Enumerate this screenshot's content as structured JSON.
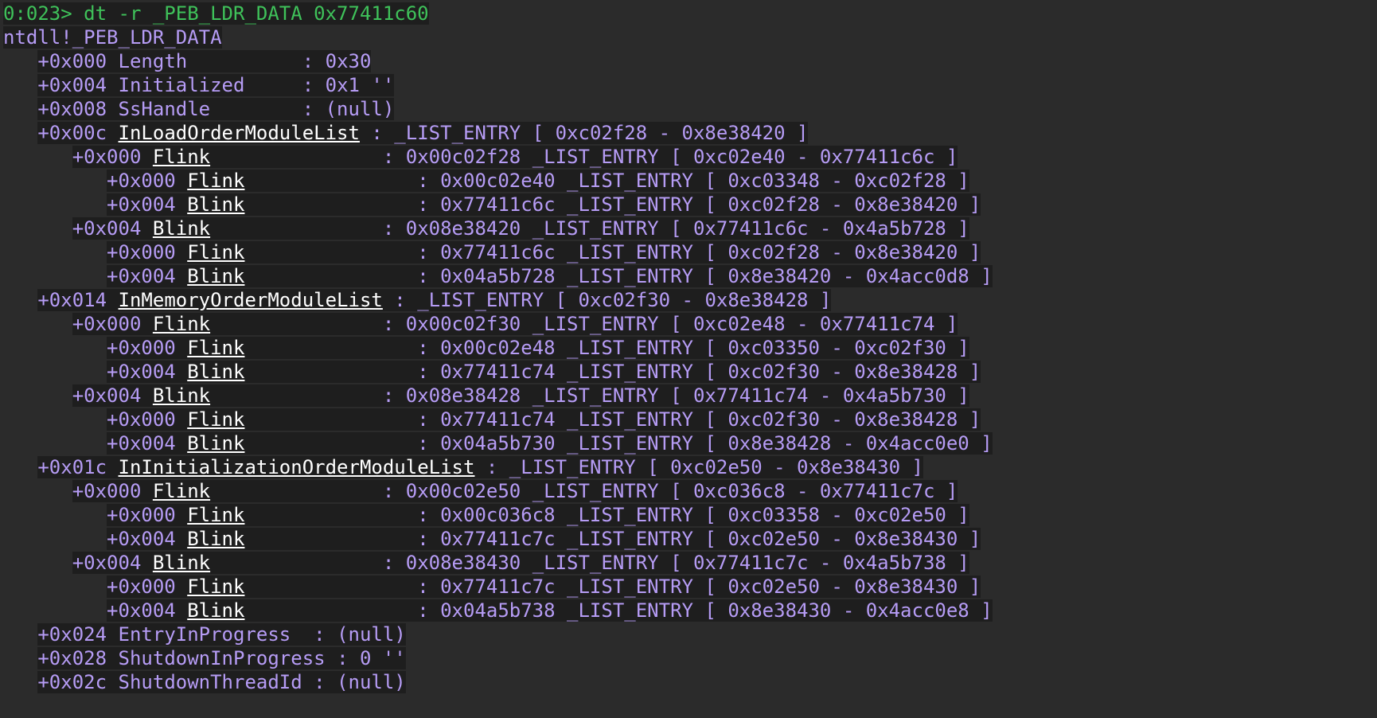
{
  "prompt": "0:023>",
  "command": "dt -r _PEB_LDR_DATA 0x77411c60",
  "colors": {
    "background": "#2b2b2b",
    "line_highlight": "#1e1e1e",
    "command": "#3fc25a",
    "output": "#b69cf5",
    "link": "#ffffff"
  },
  "lines": [
    {
      "indent": "",
      "text": "ntdll!_PEB_LDR_DATA"
    },
    {
      "indent": "   ",
      "offset": "+0x000",
      "field": "Length",
      "pad": "          ",
      "value": ": 0x30"
    },
    {
      "indent": "   ",
      "offset": "+0x004",
      "field": "Initialized",
      "pad": "     ",
      "value": ": 0x1 ''"
    },
    {
      "indent": "   ",
      "offset": "+0x008",
      "field": "SsHandle",
      "pad": "        ",
      "value": ": (null)"
    },
    {
      "indent": "   ",
      "offset": "+0x00c",
      "link": "InLoadOrderModuleList",
      "value": " : _LIST_ENTRY [ 0xc02f28 - 0x8e38420 ]"
    },
    {
      "indent": "      ",
      "offset": "+0x000",
      "link": "Flink",
      "value": "               : 0x00c02f28 _LIST_ENTRY [ 0xc02e40 - 0x77411c6c ]"
    },
    {
      "indent": "         ",
      "offset": "+0x000",
      "link": "Flink",
      "value": "               : 0x00c02e40 _LIST_ENTRY [ 0xc03348 - 0xc02f28 ]"
    },
    {
      "indent": "         ",
      "offset": "+0x004",
      "link": "Blink",
      "value": "               : 0x77411c6c _LIST_ENTRY [ 0xc02f28 - 0x8e38420 ]"
    },
    {
      "indent": "      ",
      "offset": "+0x004",
      "link": "Blink",
      "value": "               : 0x08e38420 _LIST_ENTRY [ 0x77411c6c - 0x4a5b728 ]"
    },
    {
      "indent": "         ",
      "offset": "+0x000",
      "link": "Flink",
      "value": "               : 0x77411c6c _LIST_ENTRY [ 0xc02f28 - 0x8e38420 ]"
    },
    {
      "indent": "         ",
      "offset": "+0x004",
      "link": "Blink",
      "value": "               : 0x04a5b728 _LIST_ENTRY [ 0x8e38420 - 0x4acc0d8 ]"
    },
    {
      "indent": "   ",
      "offset": "+0x014",
      "link": "InMemoryOrderModuleList",
      "value": " : _LIST_ENTRY [ 0xc02f30 - 0x8e38428 ]"
    },
    {
      "indent": "      ",
      "offset": "+0x000",
      "link": "Flink",
      "value": "               : 0x00c02f30 _LIST_ENTRY [ 0xc02e48 - 0x77411c74 ]"
    },
    {
      "indent": "         ",
      "offset": "+0x000",
      "link": "Flink",
      "value": "               : 0x00c02e48 _LIST_ENTRY [ 0xc03350 - 0xc02f30 ]"
    },
    {
      "indent": "         ",
      "offset": "+0x004",
      "link": "Blink",
      "value": "               : 0x77411c74 _LIST_ENTRY [ 0xc02f30 - 0x8e38428 ]"
    },
    {
      "indent": "      ",
      "offset": "+0x004",
      "link": "Blink",
      "value": "               : 0x08e38428 _LIST_ENTRY [ 0x77411c74 - 0x4a5b730 ]"
    },
    {
      "indent": "         ",
      "offset": "+0x000",
      "link": "Flink",
      "value": "               : 0x77411c74 _LIST_ENTRY [ 0xc02f30 - 0x8e38428 ]"
    },
    {
      "indent": "         ",
      "offset": "+0x004",
      "link": "Blink",
      "value": "               : 0x04a5b730 _LIST_ENTRY [ 0x8e38428 - 0x4acc0e0 ]"
    },
    {
      "indent": "   ",
      "offset": "+0x01c",
      "link": "InInitializationOrderModuleList",
      "value": " : _LIST_ENTRY [ 0xc02e50 - 0x8e38430 ]"
    },
    {
      "indent": "      ",
      "offset": "+0x000",
      "link": "Flink",
      "value": "               : 0x00c02e50 _LIST_ENTRY [ 0xc036c8 - 0x77411c7c ]"
    },
    {
      "indent": "         ",
      "offset": "+0x000",
      "link": "Flink",
      "value": "               : 0x00c036c8 _LIST_ENTRY [ 0xc03358 - 0xc02e50 ]"
    },
    {
      "indent": "         ",
      "offset": "+0x004",
      "link": "Blink",
      "value": "               : 0x77411c7c _LIST_ENTRY [ 0xc02e50 - 0x8e38430 ]"
    },
    {
      "indent": "      ",
      "offset": "+0x004",
      "link": "Blink",
      "value": "               : 0x08e38430 _LIST_ENTRY [ 0x77411c7c - 0x4a5b738 ]"
    },
    {
      "indent": "         ",
      "offset": "+0x000",
      "link": "Flink",
      "value": "               : 0x77411c7c _LIST_ENTRY [ 0xc02e50 - 0x8e38430 ]"
    },
    {
      "indent": "         ",
      "offset": "+0x004",
      "link": "Blink",
      "value": "               : 0x04a5b738 _LIST_ENTRY [ 0x8e38430 - 0x4acc0e8 ]"
    },
    {
      "indent": "   ",
      "offset": "+0x024",
      "field": "EntryInProgress",
      "pad": "  ",
      "value": ": (null)"
    },
    {
      "indent": "   ",
      "offset": "+0x028",
      "field": "ShutdownInProgress",
      "pad": " ",
      "value": ": 0 ''"
    },
    {
      "indent": "   ",
      "offset": "+0x02c",
      "field": "ShutdownThreadId",
      "pad": " ",
      "value": ": (null)"
    }
  ]
}
